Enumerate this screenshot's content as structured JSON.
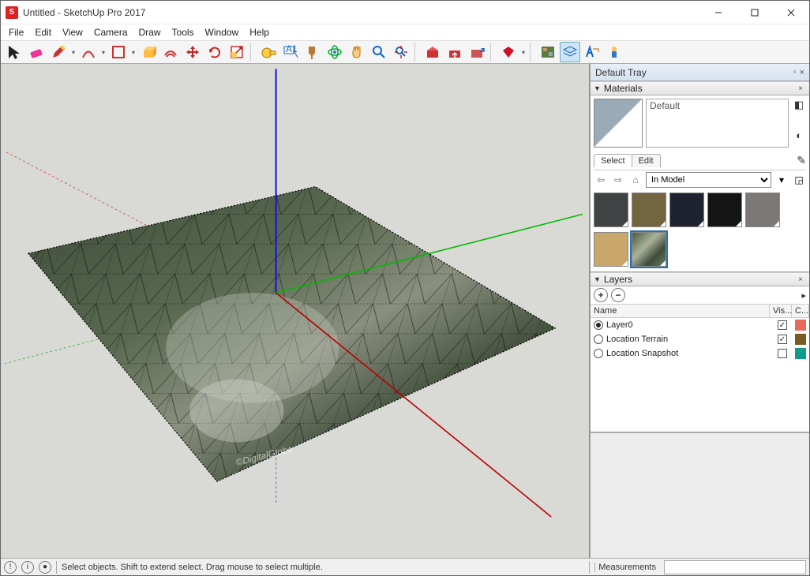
{
  "window": {
    "title": "Untitled - SketchUp Pro 2017",
    "app_icon_letter": "S"
  },
  "menu": [
    "File",
    "Edit",
    "View",
    "Camera",
    "Draw",
    "Tools",
    "Window",
    "Help"
  ],
  "toolbar_icons": [
    "select",
    "eraser",
    "pencil",
    "arc",
    "shapes",
    "pushpull",
    "offset",
    "move",
    "rotate",
    "scale",
    "sep",
    "tape",
    "text",
    "paint",
    "orbit",
    "pan",
    "zoom",
    "zoom-extents",
    "sep",
    "warehouse-get",
    "warehouse-share",
    "extension-wh",
    "sep",
    "ruby",
    "sep",
    "location",
    "layers-panel",
    "3d-text",
    "person"
  ],
  "tray": {
    "title": "Default Tray"
  },
  "materials": {
    "panel_title": "Materials",
    "current_name": "Default",
    "tabs": {
      "select": "Select",
      "edit": "Edit"
    },
    "collection": "In Model",
    "swatches": [
      {
        "name": "dark-gray",
        "color": "#3f4344"
      },
      {
        "name": "olive",
        "color": "#736540"
      },
      {
        "name": "navy",
        "color": "#1e2230"
      },
      {
        "name": "black",
        "color": "#151515"
      },
      {
        "name": "gray",
        "color": "#7c7875"
      },
      {
        "name": "tan",
        "color": "#c9a66b"
      },
      {
        "name": "satellite",
        "color": "texture",
        "selected": true
      }
    ]
  },
  "layers": {
    "panel_title": "Layers",
    "columns": {
      "name": "Name",
      "visible": "Vis...",
      "color": "C..."
    },
    "rows": [
      {
        "name": "Layer0",
        "active": true,
        "visible": true,
        "color": "#e9695c"
      },
      {
        "name": "Location Terrain",
        "active": false,
        "visible": true,
        "color": "#7a5a1f"
      },
      {
        "name": "Location Snapshot",
        "active": false,
        "visible": false,
        "color": "#0f9b8e"
      }
    ]
  },
  "status": {
    "hint": "Select objects. Shift to extend select. Drag mouse to select multiple.",
    "measurements_label": "Measurements"
  },
  "viewport": {
    "watermark": "©DigitalGlobe"
  }
}
